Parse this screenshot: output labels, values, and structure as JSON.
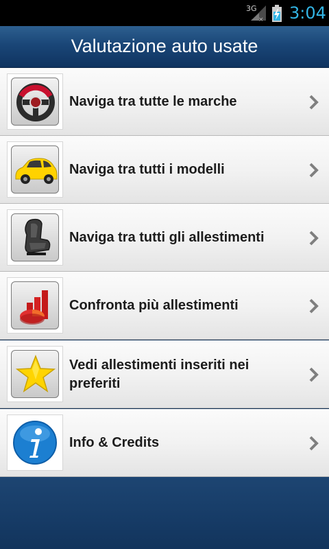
{
  "status_bar": {
    "network": "3G",
    "time": "3:04",
    "time_color": "#33b5e5"
  },
  "header": {
    "title": "Valutazione auto usate"
  },
  "menu": {
    "items": [
      {
        "label": "Naviga tra tutte le marche",
        "icon": "steering-wheel-icon"
      },
      {
        "label": "Naviga tra tutti i modelli",
        "icon": "yellow-car-icon"
      },
      {
        "label": "Naviga tra tutti gli allestimenti",
        "icon": "car-seat-icon"
      },
      {
        "label": "Confronta più allestimenti",
        "icon": "comparison-chart-icon"
      },
      {
        "label": "Vedi allestimenti inseriti nei preferiti",
        "icon": "star-icon"
      },
      {
        "label": "Info & Credits",
        "icon": "info-icon"
      }
    ]
  },
  "colors": {
    "header_blue": "#1a4677",
    "list_background": "#f2f2f2",
    "text": "#1c1c1c"
  }
}
